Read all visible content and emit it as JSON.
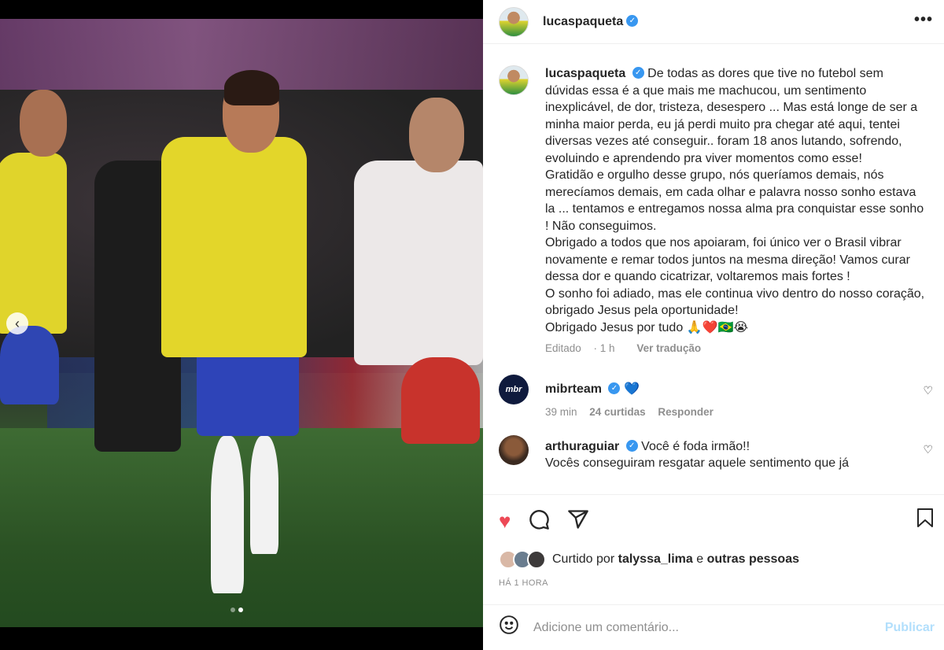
{
  "post": {
    "author": "lucaspaqueta",
    "carousel": {
      "total": 2,
      "active": 2
    }
  },
  "header": {
    "username": "lucaspaqueta",
    "more_label": "•••"
  },
  "caption": {
    "username": "lucaspaqueta",
    "text": "De todas as dores que tive no futebol sem dúvidas essa é a que mais me machucou, um sentimento inexplicável, de dor, tristeza, desespero ... Mas está longe de ser a minha maior perda, eu já perdi muito pra chegar até aqui, tentei diversas vezes até conseguir.. foram 18 anos lutando, sofrendo, evoluindo e aprendendo pra viver momentos como esse!",
    "para2": "Gratidão e orgulho desse grupo, nós queríamos demais, nós merecíamos demais, em cada olhar e palavra nosso sonho estava la ... tentamos e entregamos nossa alma pra conquistar esse sonho ! Não conseguimos.",
    "para3": "Obrigado a todos que nos apoiaram, foi único ver o Brasil vibrar novamente e remar todos juntos na mesma direção! Vamos curar dessa dor e quando cicatrizar, voltaremos mais fortes !",
    "para4": "O sonho foi adiado, mas ele continua vivo dentro do nosso coração, obrigado Jesus pela oportunidade!",
    "para5": "Obrigado Jesus por tudo 🙏❤️🇧🇷😭",
    "edited": "Editado",
    "time": "1 h",
    "see_translation": "Ver tradução"
  },
  "comments": [
    {
      "username": "mibrteam",
      "avatar_text": "mbr",
      "text": "💙",
      "time": "39 min",
      "likes": "24 curtidas",
      "reply": "Responder"
    },
    {
      "username": "arthuraguiar",
      "text": "Você é foda irmão!!",
      "text2": "Vocês conseguiram resgatar aquele sentimento que já"
    }
  ],
  "actions": {
    "liked_by_prefix": "Curtido por",
    "liked_by_user": "talyssa_lima",
    "liked_by_and": "e",
    "liked_by_others": "outras pessoas",
    "timestamp": "HÁ 1 HORA"
  },
  "add_comment": {
    "placeholder": "Adicione um comentário...",
    "publish_label": "Publicar"
  },
  "colors": {
    "accent": "#3897f0",
    "like": "#ed4956",
    "publish_disabled": "#b2dffc"
  }
}
